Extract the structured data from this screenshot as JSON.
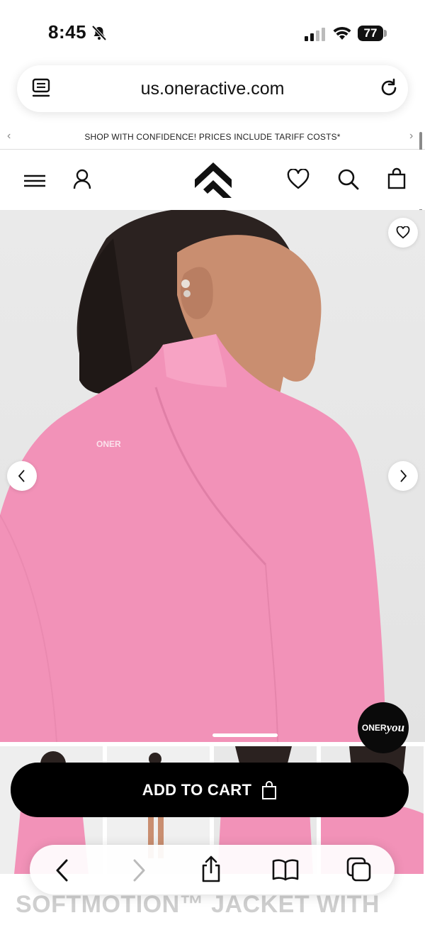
{
  "status_bar": {
    "time": "8:45",
    "battery": "77"
  },
  "browser": {
    "url": "us.oneractive.com"
  },
  "promo": {
    "text": "SHOP WITH CONFIDENCE! PRICES INCLUDE TARIFF COSTS*",
    "prev": "‹",
    "next": "›"
  },
  "header": {
    "icons": [
      "menu-icon",
      "account-icon",
      "oner-logo",
      "wishlist-icon",
      "search-icon",
      "bag-icon"
    ]
  },
  "product": {
    "garment_print": "ONER",
    "badge_prefix": "ONER",
    "badge_suffix": "you",
    "add_to_cart": "ADD TO CART",
    "title": "SOFTMOTION™ JACKET WITH"
  },
  "colors": {
    "accent": "#000000",
    "garment": "#f292b8",
    "background": "#ffffff"
  }
}
